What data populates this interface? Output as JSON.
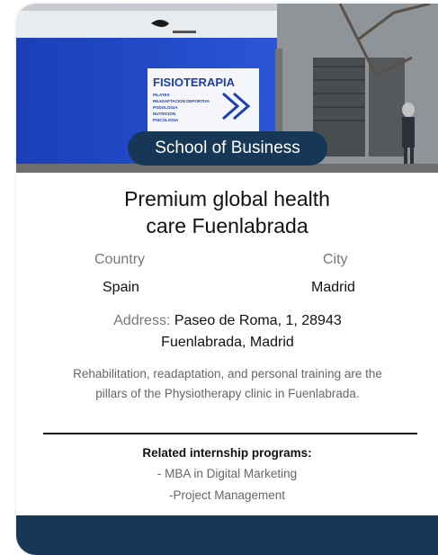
{
  "hero": {
    "image_alt": "Clinic storefront with blue facade",
    "sign_title": "FISIOTERAPIA",
    "sign_lines": [
      "PILATES",
      "READAPTACION DEPORTIVA",
      "PODOLOGIA",
      "NUTRICION",
      "PSICOLOGIA"
    ],
    "badge": "School of Business"
  },
  "title_line1": "Premium global health",
  "title_line2": "care Fuenlabrada",
  "country": {
    "label": "Country",
    "value": "Spain"
  },
  "city": {
    "label": "City",
    "value": "Madrid"
  },
  "address": {
    "label": "Address:",
    "line1": "Paseo de Roma, 1, 28943",
    "line2": "Fuenlabrada, Madrid"
  },
  "description": {
    "line1": "Rehabilitation, readaptation, and personal training are the",
    "line2": "pillars of the Physiotherapy clinic in Fuenlabrada."
  },
  "related": {
    "title": "Related internship programs:",
    "items": [
      "- MBA in Digital Marketing",
      "-Project Management"
    ]
  },
  "colors": {
    "accent": "#163755",
    "facade": "#1f47c8"
  }
}
